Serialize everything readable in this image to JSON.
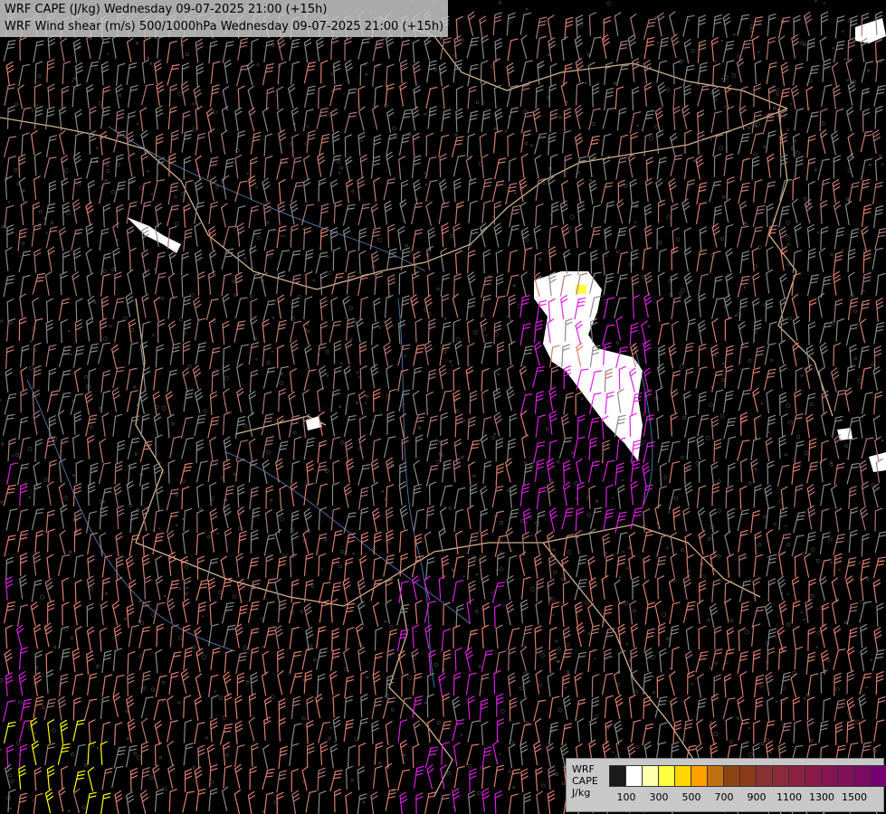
{
  "header": {
    "line1": "WRF CAPE (J/kg) Wednesday 09-07-2025 21:00 (+15h)",
    "line2": "WRF Wind shear (m/s) 500/1000hPa Wednesday 09-07-2025 21:00 (+15h)"
  },
  "legend": {
    "model": "WRF",
    "field": "CAPE",
    "unit": "J/kg",
    "colors": [
      "#1a1a1a",
      "#ffffff",
      "#ffffb0",
      "#ffff40",
      "#ffd700",
      "#ff9f00",
      "#c07010",
      "#8b4513",
      "#8b3a1a",
      "#8b3030",
      "#8b2a3a",
      "#8b2040",
      "#8a1a4a",
      "#851552",
      "#80105a",
      "#7a0a62",
      "#750070",
      "#6e0070"
    ],
    "tick_labels": [
      "100",
      "300",
      "500",
      "700",
      "900",
      "1100",
      "1300",
      "1500"
    ]
  },
  "map": {
    "background": "#000000",
    "border_color": "#d2b48c",
    "river_color": "#4a6fa5",
    "barb_colors": [
      "#8a8a8a",
      "#b07878",
      "#c88070",
      "#e08070",
      "#e060c0",
      "#e020e0",
      "#ffff00"
    ]
  }
}
